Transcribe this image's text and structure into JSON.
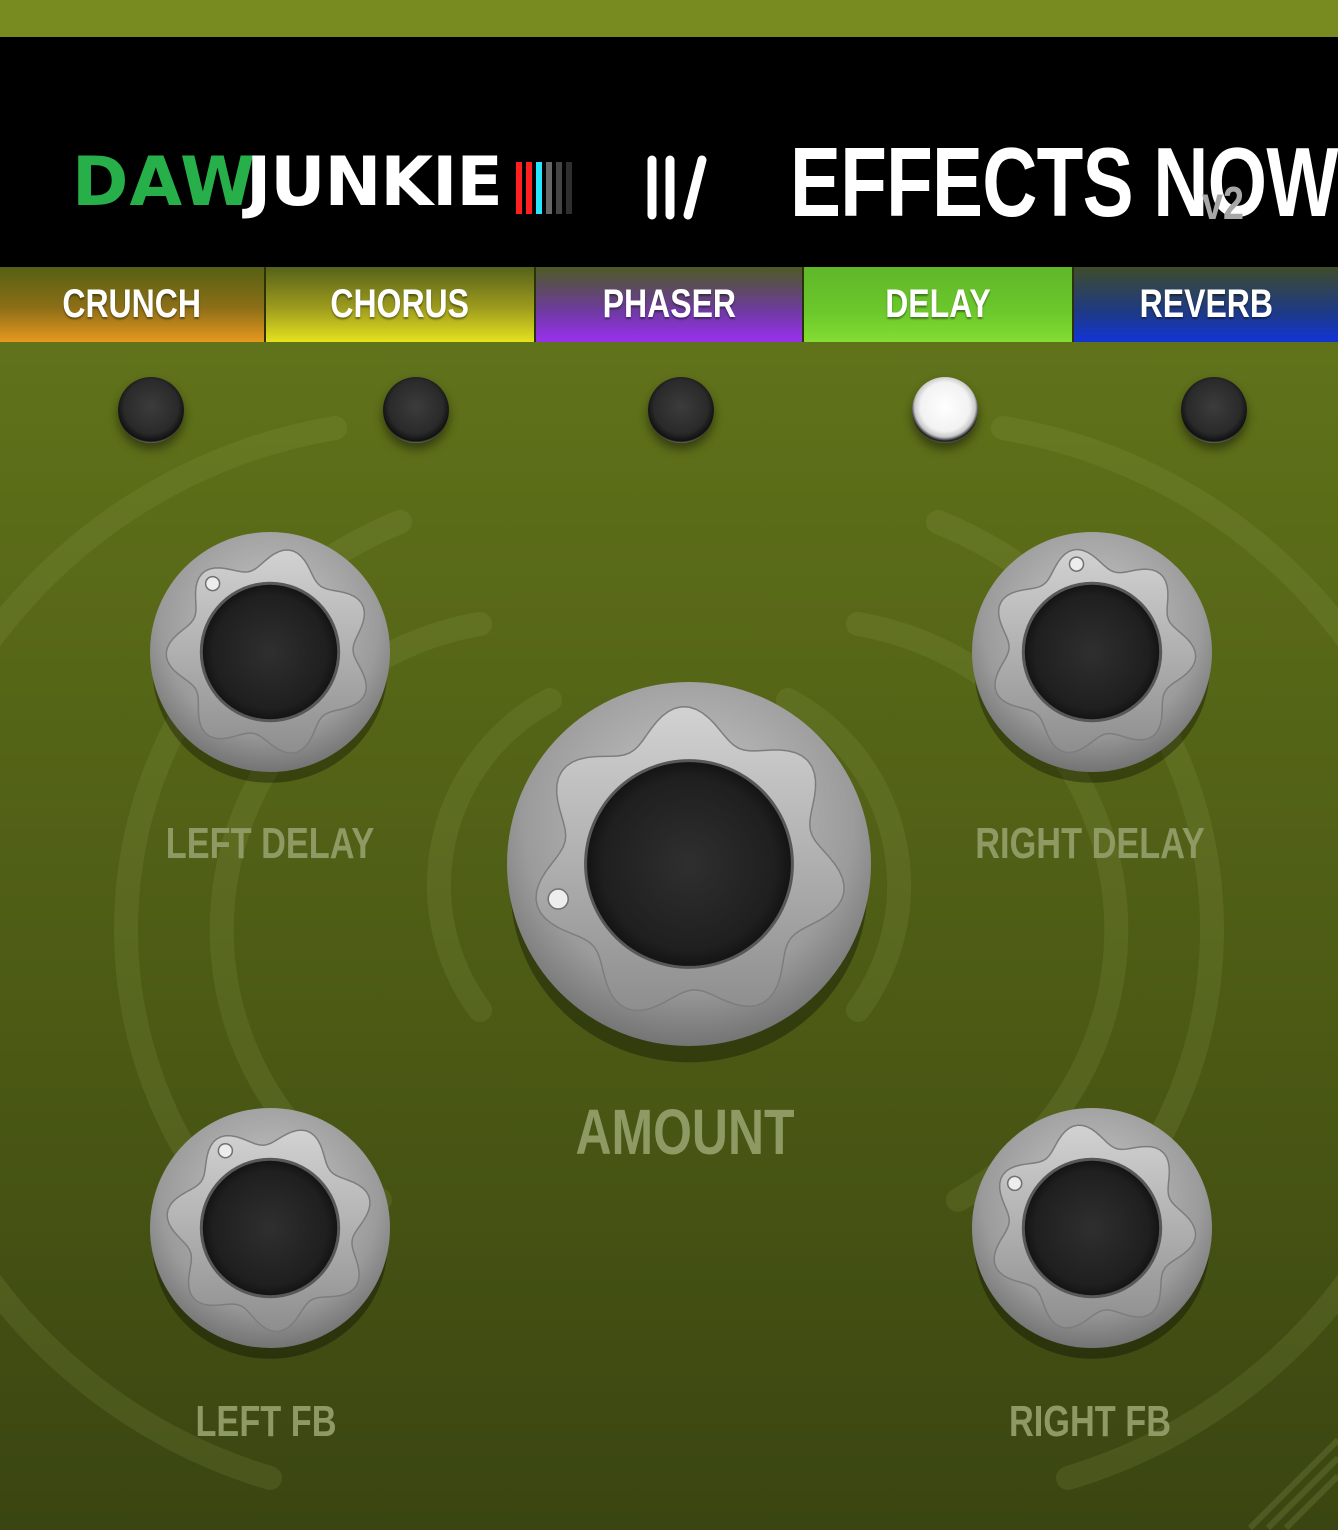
{
  "header": {
    "brand_part1": "DAW",
    "brand_part2": "JUNKIE",
    "product_name": "EFFECTS NOW",
    "version": "v2"
  },
  "tabs": [
    {
      "label": "CRUNCH",
      "active": false
    },
    {
      "label": "CHORUS",
      "active": false
    },
    {
      "label": "PHASER",
      "active": false
    },
    {
      "label": "DELAY",
      "active": true
    },
    {
      "label": "REVERB",
      "active": false
    }
  ],
  "indicators": [
    {
      "name": "crunch",
      "on": false
    },
    {
      "name": "chorus",
      "on": false
    },
    {
      "name": "phaser",
      "on": false
    },
    {
      "name": "delay",
      "on": true
    },
    {
      "name": "reverb",
      "on": false
    }
  ],
  "knobs": {
    "left_delay": {
      "label": "LEFT DELAY"
    },
    "right_delay": {
      "label": "RIGHT DELAY"
    },
    "amount": {
      "label": "AMOUNT"
    },
    "left_fb": {
      "label": "LEFT FB"
    },
    "right_fb": {
      "label": "RIGHT FB"
    }
  },
  "colors": {
    "brand_green": "#27b04a",
    "panel": "#5a6b18",
    "label": "#8d9a63",
    "crunch_tab": "#e8981f",
    "chorus_tab": "#e5e21f",
    "phaser_tab": "#9a30f0",
    "delay_tab": "#6cc82b",
    "reverb_tab": "#1234d6"
  }
}
